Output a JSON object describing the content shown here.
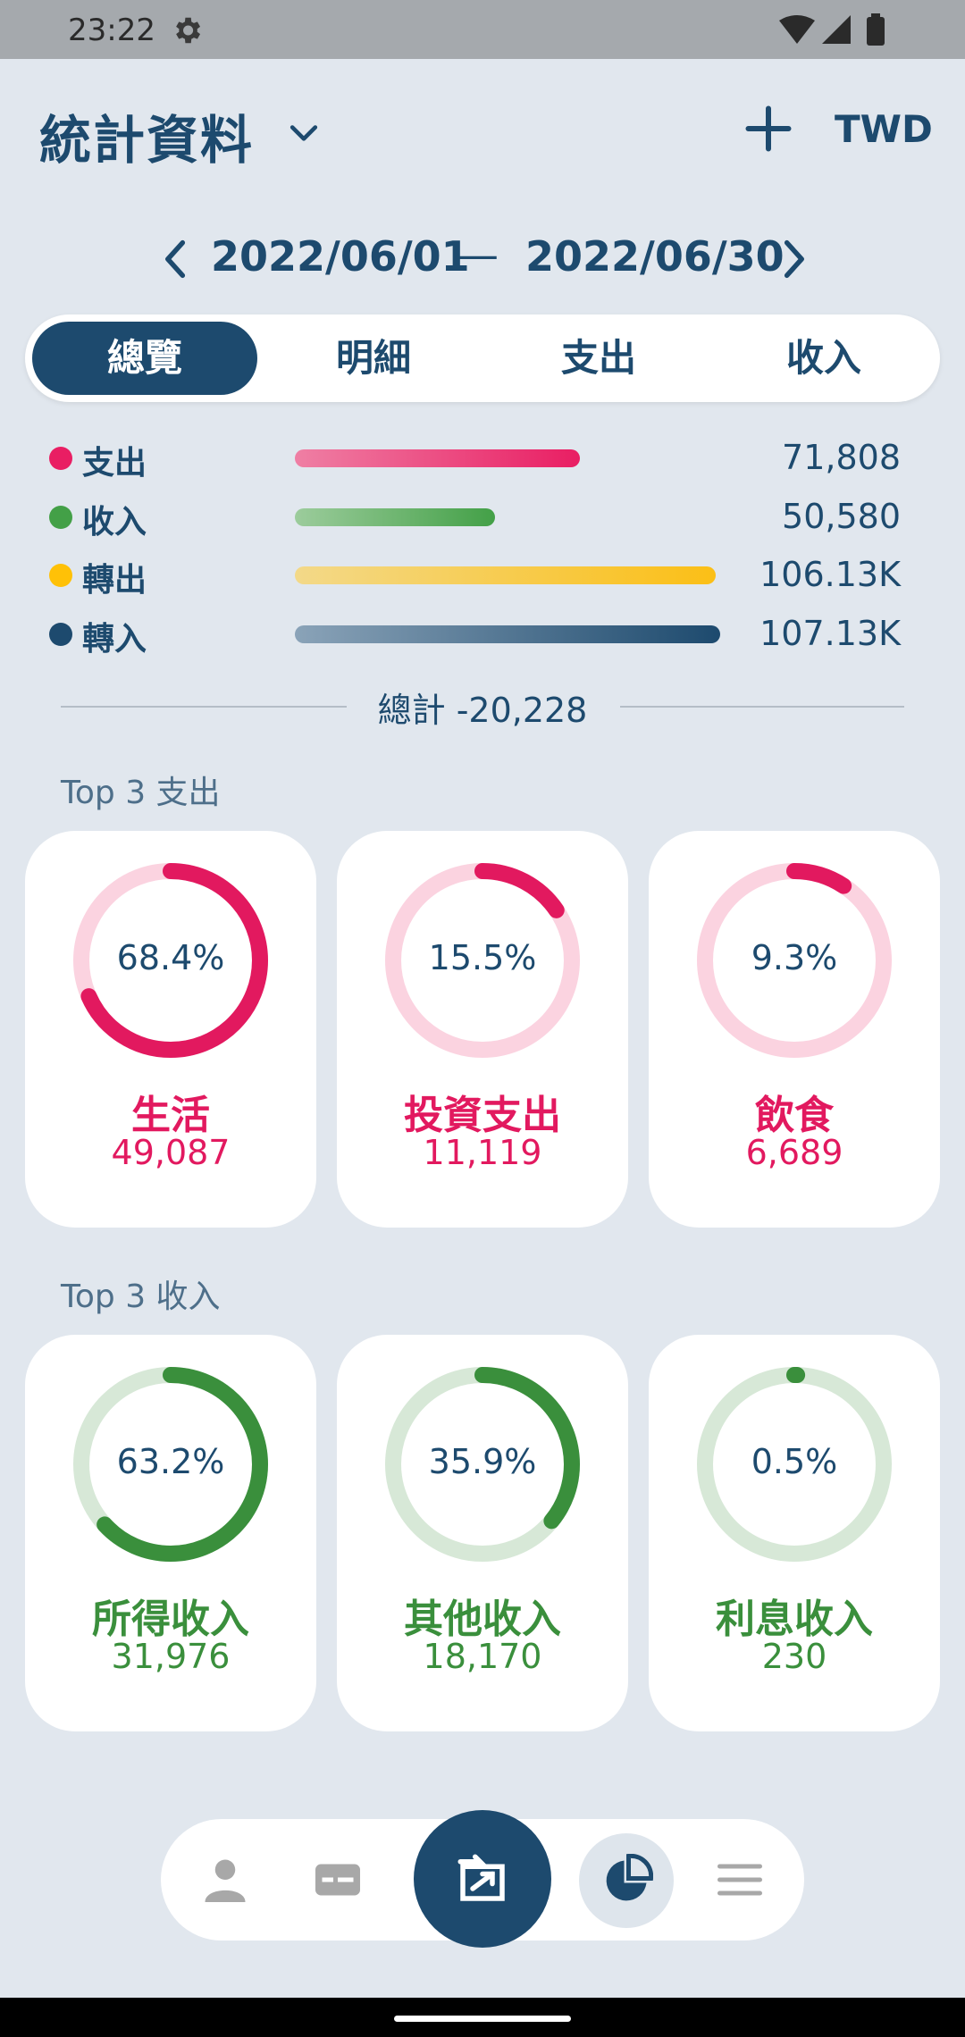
{
  "status_bar": {
    "time": "23:22"
  },
  "header": {
    "title": "統計資料",
    "currency": "TWD"
  },
  "date_range": {
    "start": "2022/06/01",
    "separator": "—",
    "end": "2022/06/30"
  },
  "tabs": [
    {
      "label": "總覽",
      "active": true
    },
    {
      "label": "明細",
      "active": false
    },
    {
      "label": "支出",
      "active": false
    },
    {
      "label": "收入",
      "active": false
    }
  ],
  "summary": [
    {
      "label": "支出",
      "value": "71,808",
      "color": "#e91e63",
      "bar_fraction": 0.67
    },
    {
      "label": "收入",
      "value": "50,580",
      "color": "#43a047",
      "bar_fraction": 0.47
    },
    {
      "label": "轉出",
      "value": "106.13K",
      "color": "#ffc107",
      "bar_fraction": 0.99
    },
    {
      "label": "轉入",
      "value": "107.13K",
      "color": "#1d4a6e",
      "bar_fraction": 1.0
    }
  ],
  "total": {
    "label": "總計 -20,228"
  },
  "top_expense": {
    "title": "Top 3 支出",
    "items": [
      {
        "percent": "68.4%",
        "fraction": 0.684,
        "category": "生活",
        "amount": "49,087"
      },
      {
        "percent": "15.5%",
        "fraction": 0.155,
        "category": "投資支出",
        "amount": "11,119"
      },
      {
        "percent": "9.3%",
        "fraction": 0.093,
        "category": "飲食",
        "amount": "6,689"
      }
    ]
  },
  "top_income": {
    "title": "Top 3 收入",
    "items": [
      {
        "percent": "63.2%",
        "fraction": 0.632,
        "category": "所得收入",
        "amount": "31,976"
      },
      {
        "percent": "35.9%",
        "fraction": 0.359,
        "category": "其他收入",
        "amount": "18,170"
      },
      {
        "percent": "0.5%",
        "fraction": 0.005,
        "category": "利息收入",
        "amount": "230"
      }
    ]
  },
  "colors": {
    "primary": "#1d4a6e",
    "expense": "#e2195f",
    "expense_light": "#fbd3e0",
    "income": "#3a8f3c",
    "income_light": "#d7e8d7",
    "background": "#e1e7ee"
  },
  "bottom_nav": [
    "person-icon",
    "card-icon",
    "add-record-icon",
    "pie-chart-icon",
    "list-icon"
  ]
}
